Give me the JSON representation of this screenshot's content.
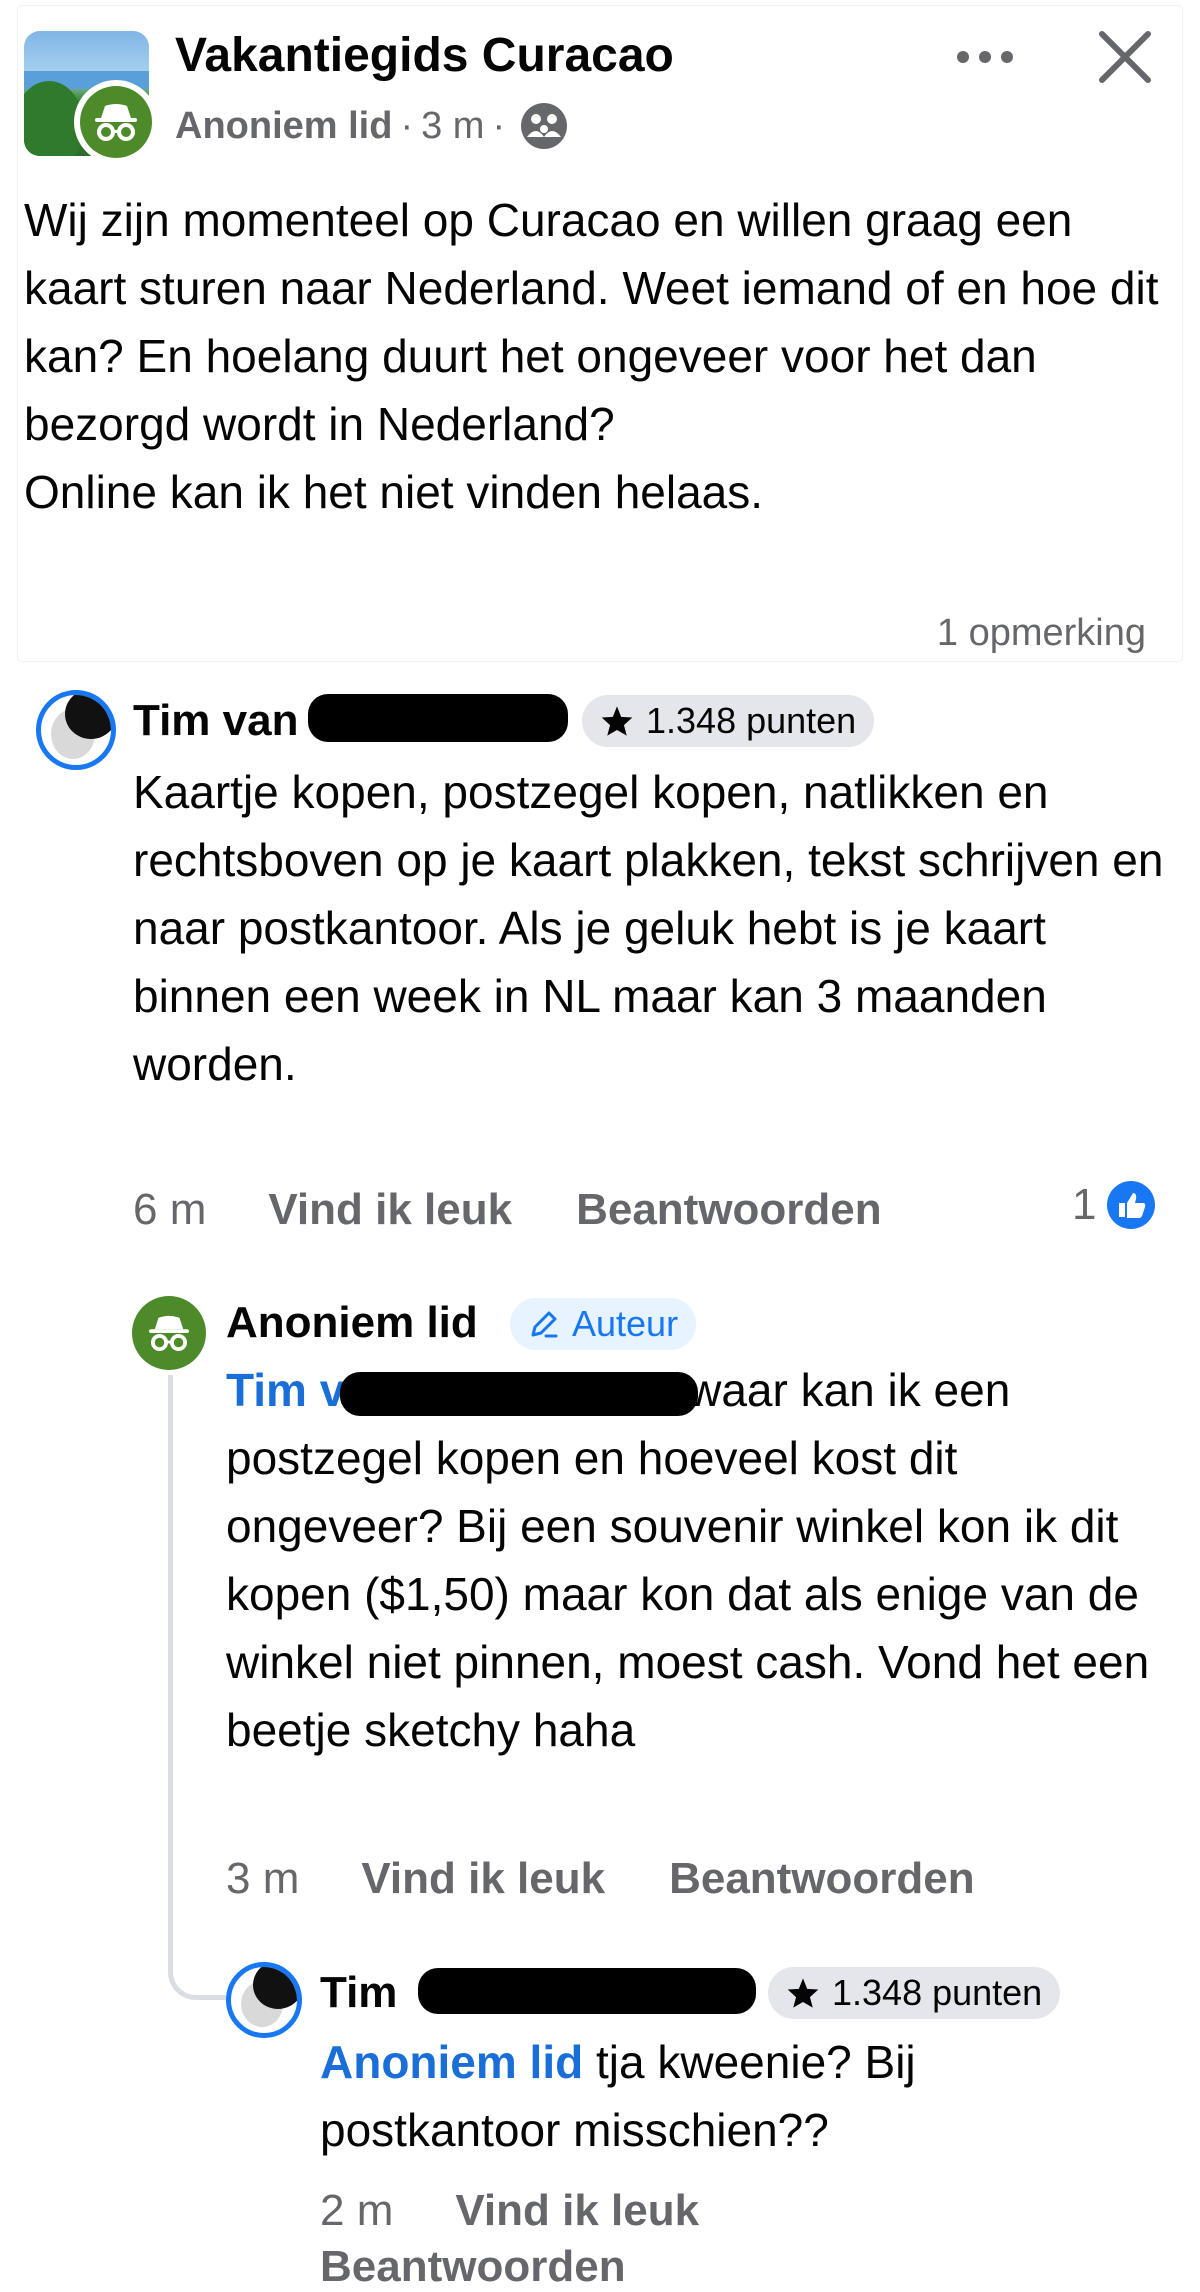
{
  "post": {
    "group_name": "Vakantiegids Curacao",
    "author": "Anoniem lid",
    "separator": "·",
    "time": "3 m",
    "privacy_icon": "group-audience-icon",
    "body": "Wij zijn momenteel op Curacao en willen graag een kaart sturen naar Nederland. Weet iemand of en hoe dit kan? En hoelang duurt het ongeveer voor het dan bezorgd wordt in Nederland?\nOnline kan ik het niet vinden helaas.",
    "comment_count": "1 opmerking",
    "more_icon": "more-horizontal-icon",
    "close_icon": "close-icon"
  },
  "comments": [
    {
      "author": "Tim van",
      "badge": "1.348 punten",
      "badge_icon": "star-icon",
      "text": "Kaartje kopen, postzegel kopen, natlikken en rechtsboven op je kaart plakken, tekst schrijven en naar postkantoor. Als je geluk hebt is je kaart binnen een week in NL maar kan 3 maanden worden.",
      "time": "6 m",
      "like_label": "Vind ik leuk",
      "reply_label": "Beantwoorden",
      "like_count": "1",
      "like_icon": "thumbs-up-icon"
    },
    {
      "author": "Anoniem lid",
      "badge": "Auteur",
      "badge_icon": "pencil-icon",
      "mention": "Tim v",
      "text": " waar kan ik een postzegel kopen en hoeveel kost dit ongeveer? Bij een souvenir winkel kon ik dit kopen ($1,50) maar kon dat als enige van de winkel niet pinnen, moest cash. Vond het een beetje sketchy haha",
      "time": "3 m",
      "like_label": "Vind ik leuk",
      "reply_label": "Beantwoorden"
    },
    {
      "author": "Tim",
      "badge": "1.348 punten",
      "badge_icon": "star-icon",
      "mention": "Anoniem lid",
      "text": " tja kweenie? Bij postkantoor misschien??",
      "time": "2 m",
      "like_label": "Vind ik leuk",
      "reply_label": "Beantwoorden"
    }
  ],
  "colors": {
    "accent_blue": "#1877f2",
    "mention_blue": "#1a6ed8",
    "anon_green": "#4d8a2a",
    "secondary_text": "#65676b"
  }
}
